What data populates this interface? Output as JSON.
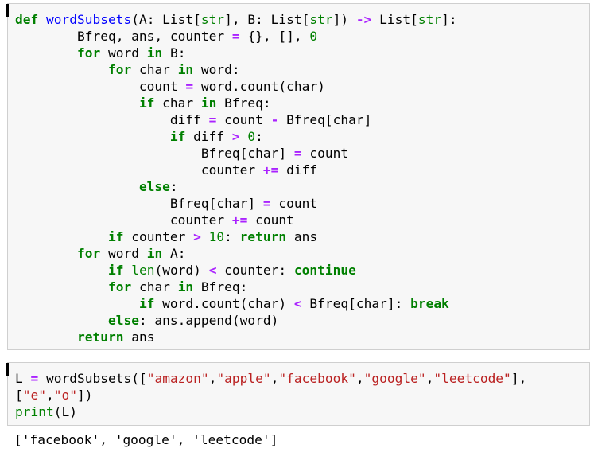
{
  "cells": [
    {
      "lines": [
        [
          [
            "kw",
            "def"
          ],
          [
            "t",
            " "
          ],
          [
            "fn",
            "wordSubsets"
          ],
          [
            "t",
            "(A: List["
          ],
          [
            "ann",
            "str"
          ],
          [
            "t",
            "], B: List["
          ],
          [
            "ann",
            "str"
          ],
          [
            "t",
            "]) "
          ],
          [
            "op",
            "->"
          ],
          [
            "t",
            " List["
          ],
          [
            "ann",
            "str"
          ],
          [
            "t",
            "]:"
          ]
        ],
        [
          [
            "t",
            "        Bfreq, ans, counter "
          ],
          [
            "op",
            "="
          ],
          [
            "t",
            " {}, [], "
          ],
          [
            "num",
            "0"
          ]
        ],
        [
          [
            "t",
            "        "
          ],
          [
            "kw",
            "for"
          ],
          [
            "t",
            " word "
          ],
          [
            "kw",
            "in"
          ],
          [
            "t",
            " B:"
          ]
        ],
        [
          [
            "t",
            "            "
          ],
          [
            "kw",
            "for"
          ],
          [
            "t",
            " char "
          ],
          [
            "kw",
            "in"
          ],
          [
            "t",
            " word:"
          ]
        ],
        [
          [
            "t",
            "                count "
          ],
          [
            "op",
            "="
          ],
          [
            "t",
            " word.count(char)"
          ]
        ],
        [
          [
            "t",
            "                "
          ],
          [
            "kw",
            "if"
          ],
          [
            "t",
            " char "
          ],
          [
            "kw",
            "in"
          ],
          [
            "t",
            " Bfreq:"
          ]
        ],
        [
          [
            "t",
            "                    diff "
          ],
          [
            "op",
            "="
          ],
          [
            "t",
            " count "
          ],
          [
            "op",
            "-"
          ],
          [
            "t",
            " Bfreq[char]"
          ]
        ],
        [
          [
            "t",
            "                    "
          ],
          [
            "kw",
            "if"
          ],
          [
            "t",
            " diff "
          ],
          [
            "op",
            ">"
          ],
          [
            "t",
            " "
          ],
          [
            "num",
            "0"
          ],
          [
            "t",
            ":"
          ]
        ],
        [
          [
            "t",
            "                        Bfreq[char] "
          ],
          [
            "op",
            "="
          ],
          [
            "t",
            " count"
          ]
        ],
        [
          [
            "t",
            "                        counter "
          ],
          [
            "op",
            "+="
          ],
          [
            "t",
            " diff"
          ]
        ],
        [
          [
            "t",
            "                "
          ],
          [
            "kw",
            "else"
          ],
          [
            "t",
            ":"
          ]
        ],
        [
          [
            "t",
            "                    Bfreq[char] "
          ],
          [
            "op",
            "="
          ],
          [
            "t",
            " count"
          ]
        ],
        [
          [
            "t",
            "                    counter "
          ],
          [
            "op",
            "+="
          ],
          [
            "t",
            " count"
          ]
        ],
        [
          [
            "t",
            "            "
          ],
          [
            "kw",
            "if"
          ],
          [
            "t",
            " counter "
          ],
          [
            "op",
            ">"
          ],
          [
            "t",
            " "
          ],
          [
            "num",
            "10"
          ],
          [
            "t",
            ": "
          ],
          [
            "kw",
            "return"
          ],
          [
            "t",
            " ans"
          ]
        ],
        [
          [
            "t",
            "        "
          ],
          [
            "kw",
            "for"
          ],
          [
            "t",
            " word "
          ],
          [
            "kw",
            "in"
          ],
          [
            "t",
            " A:"
          ]
        ],
        [
          [
            "t",
            "            "
          ],
          [
            "kw",
            "if"
          ],
          [
            "t",
            " "
          ],
          [
            "bi",
            "len"
          ],
          [
            "t",
            "(word) "
          ],
          [
            "op",
            "<"
          ],
          [
            "t",
            " counter: "
          ],
          [
            "kw",
            "continue"
          ]
        ],
        [
          [
            "t",
            "            "
          ],
          [
            "kw",
            "for"
          ],
          [
            "t",
            " char "
          ],
          [
            "kw",
            "in"
          ],
          [
            "t",
            " Bfreq:"
          ]
        ],
        [
          [
            "t",
            "                "
          ],
          [
            "kw",
            "if"
          ],
          [
            "t",
            " word.count(char) "
          ],
          [
            "op",
            "<"
          ],
          [
            "t",
            " Bfreq[char]: "
          ],
          [
            "kw",
            "break"
          ]
        ],
        [
          [
            "t",
            "            "
          ],
          [
            "kw",
            "else"
          ],
          [
            "t",
            ": ans.append(word)"
          ]
        ],
        [
          [
            "t",
            "        "
          ],
          [
            "kw",
            "return"
          ],
          [
            "t",
            " ans"
          ]
        ]
      ]
    },
    {
      "lines": [
        [
          [
            "t",
            "L "
          ],
          [
            "op",
            "="
          ],
          [
            "t",
            " wordSubsets(["
          ],
          [
            "str",
            "\"amazon\""
          ],
          [
            "t",
            ","
          ],
          [
            "str",
            "\"apple\""
          ],
          [
            "t",
            ","
          ],
          [
            "str",
            "\"facebook\""
          ],
          [
            "t",
            ","
          ],
          [
            "str",
            "\"google\""
          ],
          [
            "t",
            ","
          ],
          [
            "str",
            "\"leetcode\""
          ],
          [
            "t",
            "],"
          ]
        ],
        [
          [
            "t",
            "["
          ],
          [
            "str",
            "\"e\""
          ],
          [
            "t",
            ","
          ],
          [
            "str",
            "\"o\""
          ],
          [
            "t",
            "])"
          ]
        ],
        [
          [
            "bi",
            "print"
          ],
          [
            "t",
            "(L)"
          ]
        ]
      ]
    }
  ],
  "output": "['facebook', 'google', 'leetcode']"
}
